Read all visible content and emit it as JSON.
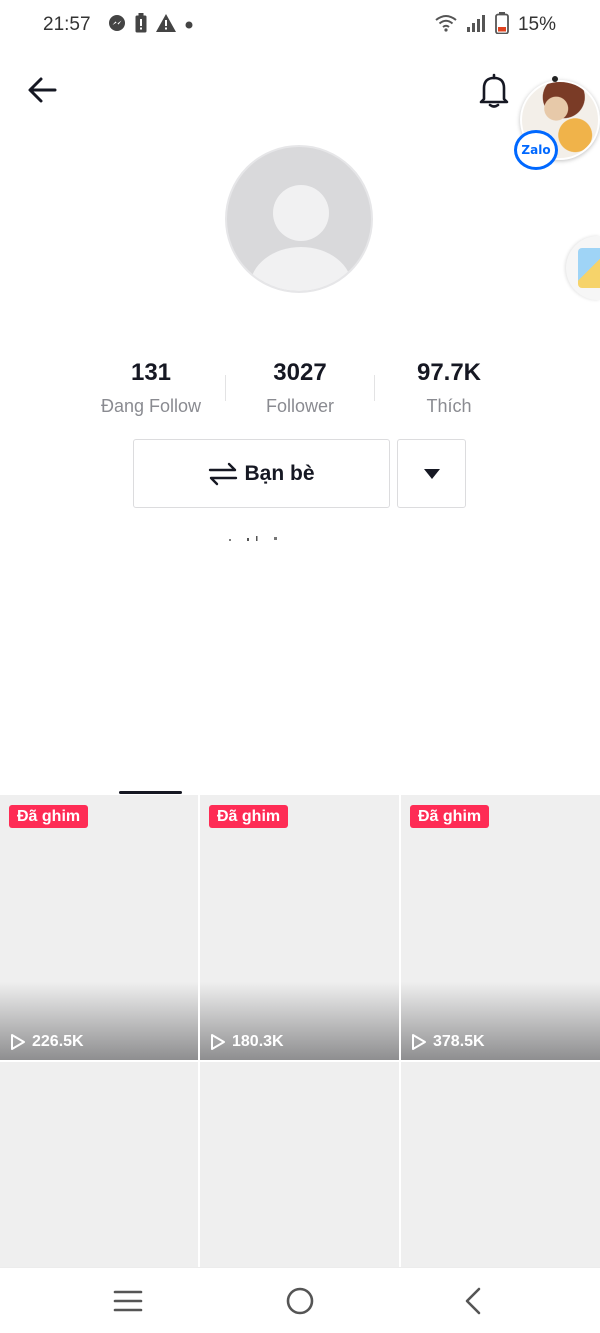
{
  "status_bar": {
    "time": "21:57",
    "left_icons": [
      "messenger-icon",
      "battery-saver-icon",
      "warning-icon",
      "dot-icon"
    ],
    "right_icons": [
      "wifi-icon",
      "signal-icon",
      "battery-icon"
    ],
    "battery_text": "15%"
  },
  "header": {
    "back_icon": "arrow-left-icon",
    "bell_icon": "bell-icon"
  },
  "chat_head": {
    "badge_text": "Zalo",
    "accent_color": "#0068ff"
  },
  "profile": {
    "stats": [
      {
        "value": "131",
        "label": "Đang Follow"
      },
      {
        "value": "3027",
        "label": "Follower"
      },
      {
        "value": "97.7K",
        "label": "Thích"
      }
    ],
    "friends_button_label": "Bạn bè",
    "more_button_icon": "caret-down-icon"
  },
  "videos": {
    "pinned_label": "Đã ghim",
    "badge_color": "#fe2c55",
    "tiles": [
      {
        "pinned": true,
        "views": "226.5K"
      },
      {
        "pinned": true,
        "views": "180.3K"
      },
      {
        "pinned": true,
        "views": "378.5K"
      },
      {
        "pinned": false,
        "views": ""
      },
      {
        "pinned": false,
        "views": ""
      },
      {
        "pinned": false,
        "views": ""
      }
    ]
  },
  "nav_bar": {
    "icons": [
      "recent-apps-icon",
      "home-icon",
      "back-icon"
    ]
  }
}
